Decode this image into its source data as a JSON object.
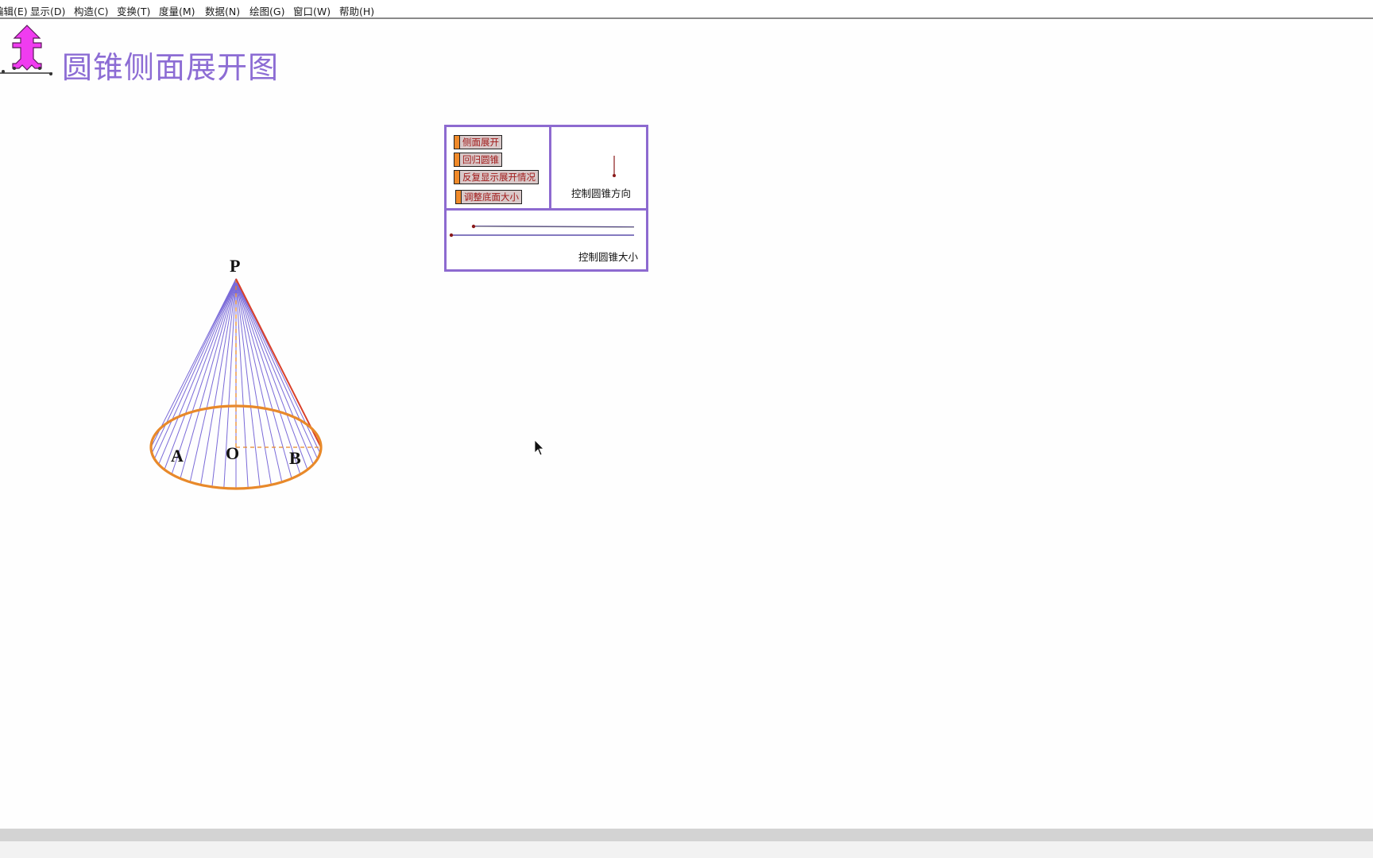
{
  "menu": {
    "items": [
      {
        "label": "编辑(E)"
      },
      {
        "label": "显示(D)"
      },
      {
        "label": "构造(C)"
      },
      {
        "label": "变换(T)"
      },
      {
        "label": "度量(M)"
      },
      {
        "label": "数据(N)"
      },
      {
        "label": "绘图(G)"
      },
      {
        "label": "窗口(W)"
      },
      {
        "label": "帮助(H)"
      }
    ]
  },
  "document": {
    "title": "圆锥侧面展开图",
    "logo_icon": "sketchpad-logo-icon"
  },
  "panel": {
    "buttons": [
      {
        "label": "侧面展开"
      },
      {
        "label": "回归圆锥"
      },
      {
        "label": "反复显示展开情况"
      },
      {
        "label": "调整底面大小"
      }
    ],
    "direction_label": "控制圆锥方向",
    "size_label": "控制圆锥大小"
  },
  "figure": {
    "points": {
      "apex": "P",
      "left": "A",
      "center": "O",
      "right": "B"
    },
    "colors": {
      "generatrix": "#7a6ad8",
      "base": "#e8892a",
      "edge": "#d9402a",
      "title": "#8c6cd4",
      "panel_border": "#8d6ad0"
    }
  }
}
